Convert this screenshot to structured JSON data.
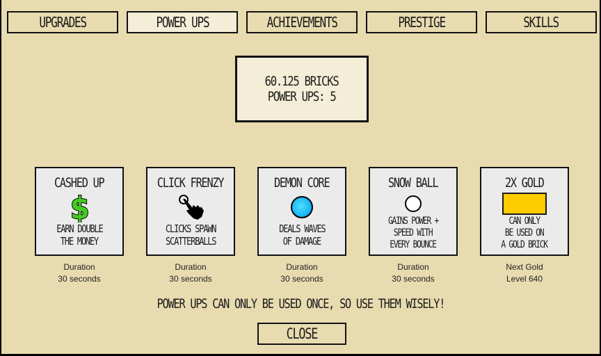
{
  "tabs": [
    {
      "label": "Upgrades",
      "active": false
    },
    {
      "label": "Power Ups",
      "active": true
    },
    {
      "label": "Achievements",
      "active": false
    },
    {
      "label": "Prestige",
      "active": false
    },
    {
      "label": "Skills",
      "active": false
    }
  ],
  "status": {
    "bricks": "60.125 Bricks",
    "power_ups": "Power Ups: 5"
  },
  "powerups": [
    {
      "title": "Cashed Up",
      "icon": "dollar-sign-icon",
      "icon_color": "#44CC22",
      "desc": [
        "Earn Double",
        "the Money"
      ],
      "meta_label": "Duration",
      "meta_value": "30 seconds"
    },
    {
      "title": "Click Frenzy",
      "icon": "pointing-hand-click-icon",
      "icon_color": "#000000",
      "desc": [
        "Clicks Spawn",
        "Scatterballs"
      ],
      "meta_label": "Duration",
      "meta_value": "30 seconds"
    },
    {
      "title": "Demon Core",
      "icon": "blue-ball-icon",
      "icon_color": "#1AB8F5",
      "desc": [
        "Deals Waves",
        "of Damage"
      ],
      "meta_label": "Duration",
      "meta_value": "30 seconds"
    },
    {
      "title": "Snow Ball",
      "icon": "white-ball-icon",
      "icon_color": "#FFFFFF",
      "desc": [
        "Gains Power +",
        "Speed with",
        "Every Bounce"
      ],
      "meta_label": "Duration",
      "meta_value": "30 seconds"
    },
    {
      "title": "2X Gold",
      "icon": "gold-brick-icon",
      "icon_color": "#FFCC00",
      "desc": [
        "Can Only",
        "Be Used On",
        "A Gold Brick"
      ],
      "meta_label": "Next Gold",
      "meta_value": "Level 640"
    }
  ],
  "notice": "Power Ups can only be used once, so use them wisely!",
  "close_label": "Close"
}
